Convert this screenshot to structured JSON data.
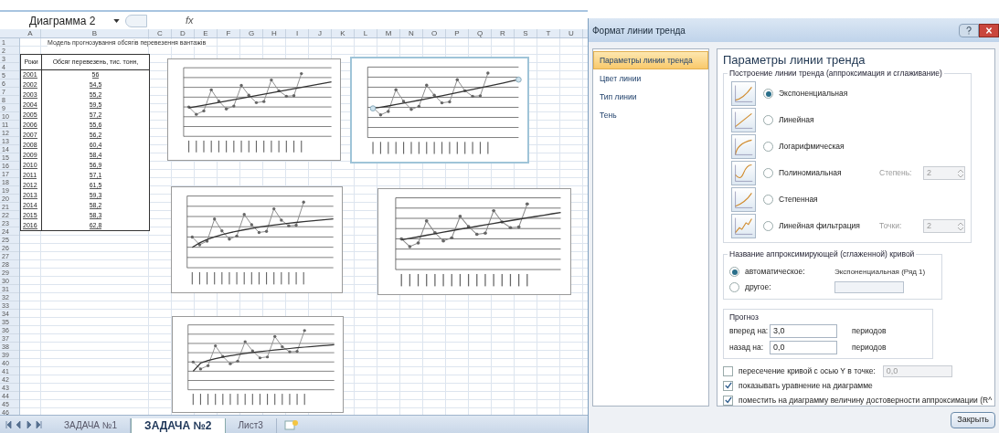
{
  "formula_bar": {
    "name_box": "Диаграмма 2",
    "fx": "fx"
  },
  "sheet": {
    "column_headers": [
      "A",
      "B",
      "C",
      "D",
      "E",
      "F",
      "G",
      "H",
      "I",
      "J",
      "K",
      "L",
      "M",
      "N",
      "O",
      "P",
      "Q",
      "R",
      "S",
      "T",
      "U"
    ],
    "row_numbers": [
      "1",
      "2",
      "3",
      "4",
      "5",
      "6",
      "7",
      "8",
      "9",
      "10",
      "11",
      "12",
      "13",
      "14",
      "15",
      "16",
      "17",
      "18",
      "19",
      "20",
      "21",
      "22",
      "23",
      "24",
      "25",
      "26",
      "27",
      "28",
      "29",
      "30",
      "31",
      "32",
      "33",
      "34",
      "35",
      "36",
      "37",
      "38",
      "39",
      "40",
      "41",
      "42",
      "43",
      "44",
      "45",
      "46"
    ],
    "title": "Модель прогнозування обсягів перевезення вантажів",
    "table": {
      "columns": [
        "Роки",
        "Обсяг перевезень, тис. тонн,"
      ],
      "rows": [
        [
          "2001",
          "56"
        ],
        [
          "2002",
          "54,5"
        ],
        [
          "2003",
          "55,2"
        ],
        [
          "2004",
          "59,5"
        ],
        [
          "2005",
          "57,2"
        ],
        [
          "2006",
          "55,6"
        ],
        [
          "2007",
          "56,2"
        ],
        [
          "2008",
          "60,4"
        ],
        [
          "2009",
          "58,4"
        ],
        [
          "2010",
          "56,9"
        ],
        [
          "2011",
          "57,1"
        ],
        [
          "2012",
          "61,5"
        ],
        [
          "2013",
          "59,3"
        ],
        [
          "2014",
          "58,2"
        ],
        [
          "2015",
          "58,3"
        ],
        [
          "2016",
          "62,8"
        ]
      ]
    },
    "charts": [
      {
        "kind": "linear",
        "selected": false
      },
      {
        "kind": "exponential",
        "selected": true
      },
      {
        "kind": "logarithmic",
        "selected": false
      },
      {
        "kind": "polynomial",
        "selected": false
      },
      {
        "kind": "power",
        "selected": false
      }
    ]
  },
  "sheet_tabs": [
    {
      "label": "ЗАДАЧА №1",
      "selected": false
    },
    {
      "label": "ЗАДАЧА №2",
      "selected": true
    },
    {
      "label": "Лист3",
      "selected": false
    }
  ],
  "dialog": {
    "title": "Формат линии тренда",
    "nav": [
      {
        "label": "Параметры линии тренда",
        "selected": true
      },
      {
        "label": "Цвет линии",
        "selected": false
      },
      {
        "label": "Тип линии",
        "selected": false
      },
      {
        "label": "Тень",
        "selected": false
      }
    ],
    "heading": "Параметры линии тренда",
    "trend_group": {
      "title": "Построение линии тренда (аппроксимация и сглаживание)",
      "options": [
        {
          "label": "Экспоненциальная",
          "selected": true
        },
        {
          "label": "Линейная",
          "selected": false
        },
        {
          "label": "Логарифмическая",
          "selected": false
        },
        {
          "label": "Полиномиальная",
          "selected": false,
          "param_label": "Степень:",
          "param_value": "2",
          "disabled": true
        },
        {
          "label": "Степенная",
          "selected": false
        },
        {
          "label": "Линейная фильтрация",
          "selected": false,
          "param_label": "Точки:",
          "param_value": "2",
          "disabled": true
        }
      ]
    },
    "name_group": {
      "title": "Название аппроксимирующей (сглаженной) кривой",
      "options": [
        {
          "label": "автоматическое:",
          "selected": true,
          "value": "Экспоненциальная (Ряд 1)"
        },
        {
          "label": "другое:",
          "selected": false
        }
      ]
    },
    "forecast": {
      "title": "Прогноз",
      "rows": [
        {
          "label": "вперед на:",
          "value": "3,0",
          "unit": "периодов"
        },
        {
          "label": "назад на:",
          "value": "0,0",
          "unit": "периодов"
        }
      ]
    },
    "checks": [
      {
        "label": "пересечение кривой с осью Y в точке:",
        "checked": false,
        "value": "0,0"
      },
      {
        "label": "показывать уравнение на диаграмме",
        "checked": true
      },
      {
        "label": "поместить на диаграмму величину достоверности аппроксимации (R^",
        "checked": true
      }
    ],
    "close_button": "Закрыть"
  }
}
